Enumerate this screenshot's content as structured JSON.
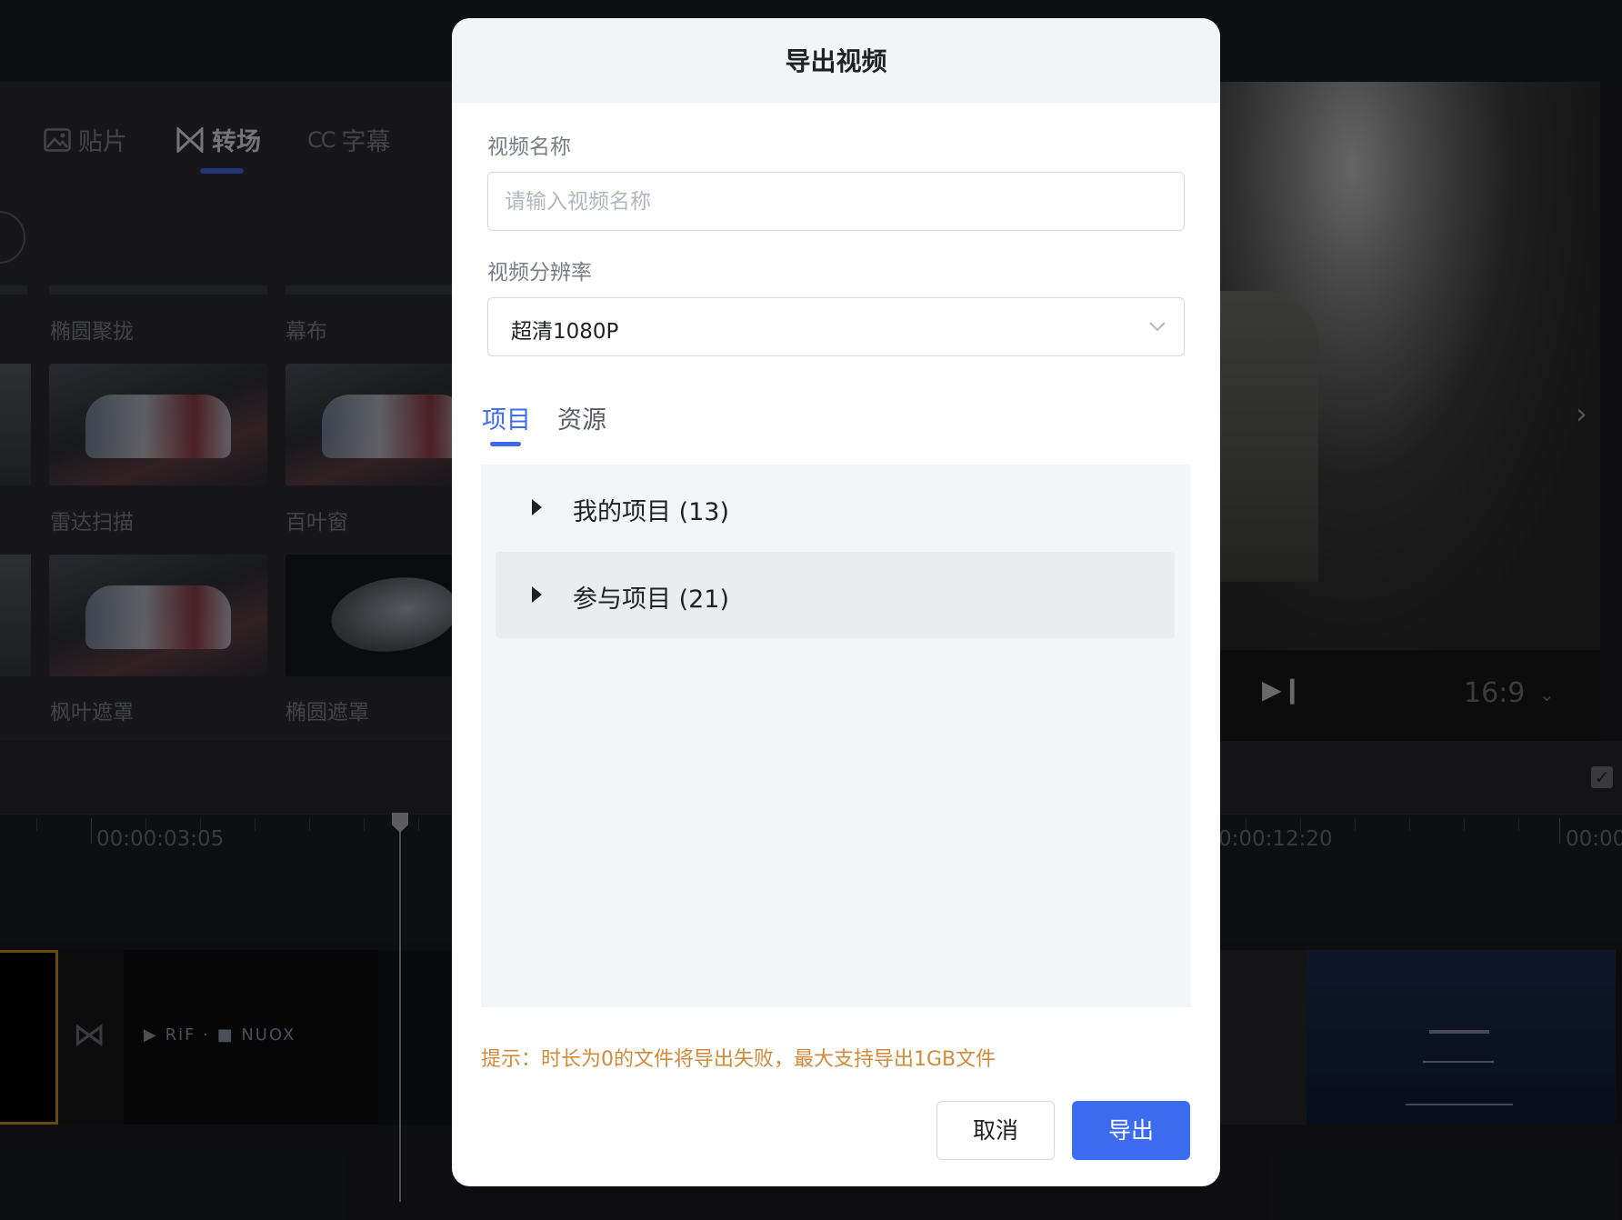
{
  "editor": {
    "tabs": [
      {
        "label": "贴片"
      },
      {
        "label": "转场"
      },
      {
        "label": "字幕"
      }
    ],
    "tab_prefix_cc": "CC",
    "transitions": [
      {
        "label": "椭圆聚拢"
      },
      {
        "label": "幕布"
      },
      {
        "label": "雷达扫描"
      },
      {
        "label": "百叶窗"
      },
      {
        "label": "枫叶遮罩"
      },
      {
        "label": "椭圆遮罩"
      }
    ],
    "aspect_ratio": "16:9",
    "timecodes": [
      "00:00:03:05",
      "0:00:12:20",
      "00:00"
    ],
    "clip_text": "▶ RiF · ■ NUOX"
  },
  "modal": {
    "title": "导出视频",
    "name_label": "视频名称",
    "name_placeholder": "请输入视频名称",
    "resolution_label": "视频分辨率",
    "resolution_value": "超清1080P",
    "tabs": [
      {
        "label": "项目"
      },
      {
        "label": "资源"
      }
    ],
    "tree": [
      {
        "label": "我的项目 (13)"
      },
      {
        "label": "参与项目 (21)"
      }
    ],
    "hint": "提示：时长为0的文件将导出失败，最大支持导出1GB文件",
    "cancel_label": "取消",
    "export_label": "导出"
  },
  "colors": {
    "accent": "#3d6bf0",
    "hint": "#d08a3c",
    "selected_clip_border": "#b38a1e"
  }
}
